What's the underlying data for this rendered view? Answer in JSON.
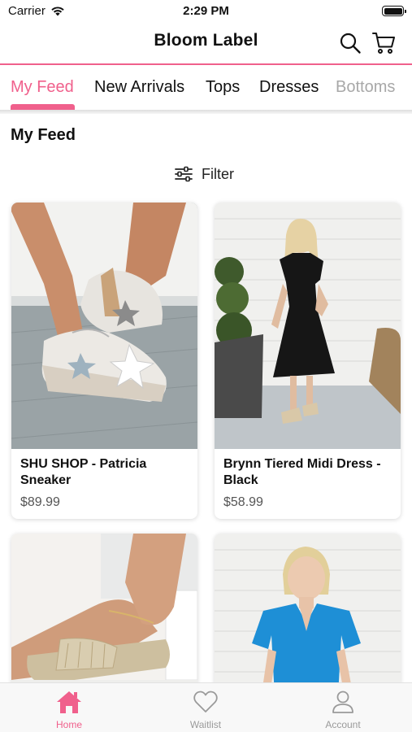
{
  "status": {
    "carrier": "Carrier",
    "time": "2:29 PM"
  },
  "header": {
    "title": "Bloom Label",
    "icons": [
      "search-icon",
      "cart-icon"
    ]
  },
  "tabs": [
    {
      "label": "My Feed",
      "active": true
    },
    {
      "label": "New Arrivals"
    },
    {
      "label": "Tops"
    },
    {
      "label": "Dresses"
    },
    {
      "label": "Bottoms"
    }
  ],
  "section": {
    "title": "My Feed"
  },
  "filter": {
    "label": "Filter",
    "icon": "sliders-icon"
  },
  "products": [
    {
      "name": "SHU SHOP - Patricia Sneaker",
      "price": "$89.99"
    },
    {
      "name": "Brynn Tiered Midi Dress - Black",
      "price": "$58.99"
    },
    {
      "name": "",
      "price": ""
    },
    {
      "name": "",
      "price": ""
    }
  ],
  "bottom_nav": [
    {
      "label": "Home",
      "icon": "home-icon",
      "active": true
    },
    {
      "label": "Waitlist",
      "icon": "heart-icon"
    },
    {
      "label": "Account",
      "icon": "person-icon"
    }
  ],
  "colors": {
    "accent": "#f0608c",
    "inactive": "#9a9a9a"
  }
}
